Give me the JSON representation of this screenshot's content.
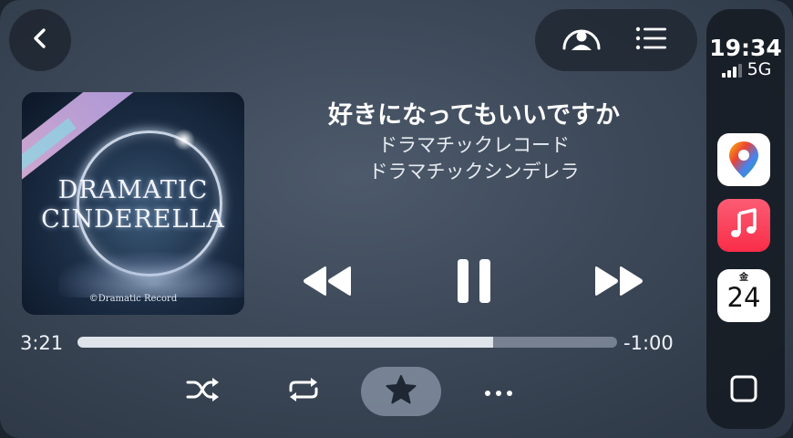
{
  "now_playing": {
    "title": "好きになってもいいですか",
    "artist": "ドラマチックレコード",
    "album": "ドラマチックシンデレラ",
    "progress": {
      "elapsed": "3:21",
      "remaining": "-1:00",
      "fraction": 0.77
    }
  },
  "album_art": {
    "title_line1": "DRAMATIC",
    "title_line2": "CINDERELLA",
    "label": "©Dramatic Record"
  },
  "toolbar": {
    "back_icon": "chevron-left-icon",
    "listeners_icon": "shareplay-icon",
    "queue_icon": "list-icon"
  },
  "controls": {
    "rewind_icon": "rewind-icon",
    "pause_icon": "pause-icon",
    "forward_icon": "fast-forward-icon",
    "shuffle_icon": "shuffle-icon",
    "repeat_icon": "repeat-icon",
    "favorite_icon": "star-icon",
    "more_icon": "ellipsis-icon"
  },
  "status": {
    "time": "19:34",
    "network": "5G",
    "signal_bars": 3,
    "signal_bars_max": 4
  },
  "dock_apps": [
    {
      "name": "Maps",
      "icon": "maps-icon"
    },
    {
      "name": "Music",
      "icon": "music-note-icon"
    },
    {
      "name": "Calendar",
      "icon": "calendar-icon",
      "day": "金",
      "date": "24"
    }
  ],
  "colors": {
    "music_red": "#fa2d48",
    "progress_fill": "#dfe3ea",
    "favorite_bg": "#8c98aa"
  }
}
